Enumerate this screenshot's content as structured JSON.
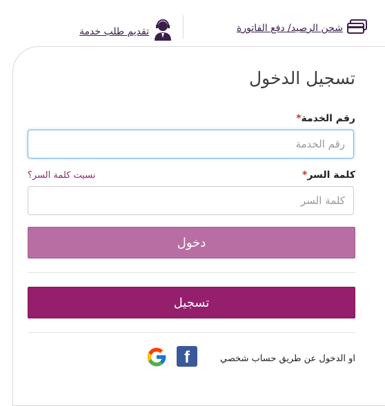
{
  "top_links": {
    "recharge": "شحن الرصيد/ دفع الفاتورة",
    "request_service": "تقديم طلب خدمة"
  },
  "login": {
    "title": "تسجيل الدخول",
    "service_label": "رقم الخدمة",
    "service_placeholder": "رقم الخدمة",
    "password_label": "كلمة السر",
    "password_placeholder": "كلمة السر",
    "required_mark": "*",
    "forgot": "نسيت كلمة السر؟",
    "login_button": "دخول",
    "register_button": "تسجيل",
    "social_text": "او الدخول عن طريق حساب شخصي",
    "facebook_letter": "f"
  },
  "colors": {
    "brand": "#951f6c",
    "login_button": "#b96ea3",
    "facebook": "#3b5998"
  },
  "icons": [
    "credit-card-icon",
    "person-support-icon",
    "facebook-icon",
    "google-icon"
  ]
}
